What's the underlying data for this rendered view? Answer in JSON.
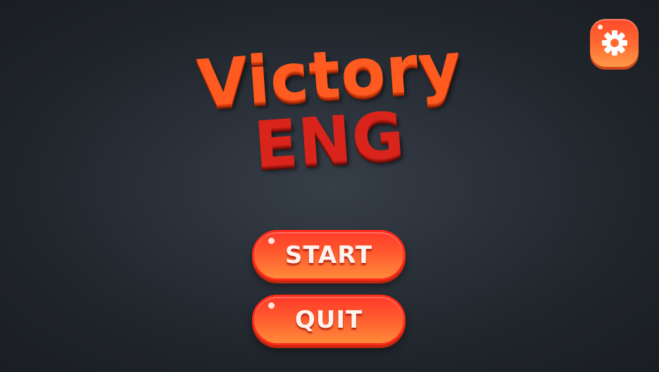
{
  "title": {
    "line1": "Victory",
    "line2": "ENG"
  },
  "menu": {
    "start_label": "START",
    "quit_label": "QUIT"
  },
  "settings": {
    "icon": "gear-icon"
  },
  "colors": {
    "title_primary": "#ff5a1f",
    "title_secondary": "#d8241a",
    "button_accent": "#ff5a2e",
    "background": "#2a3038"
  }
}
